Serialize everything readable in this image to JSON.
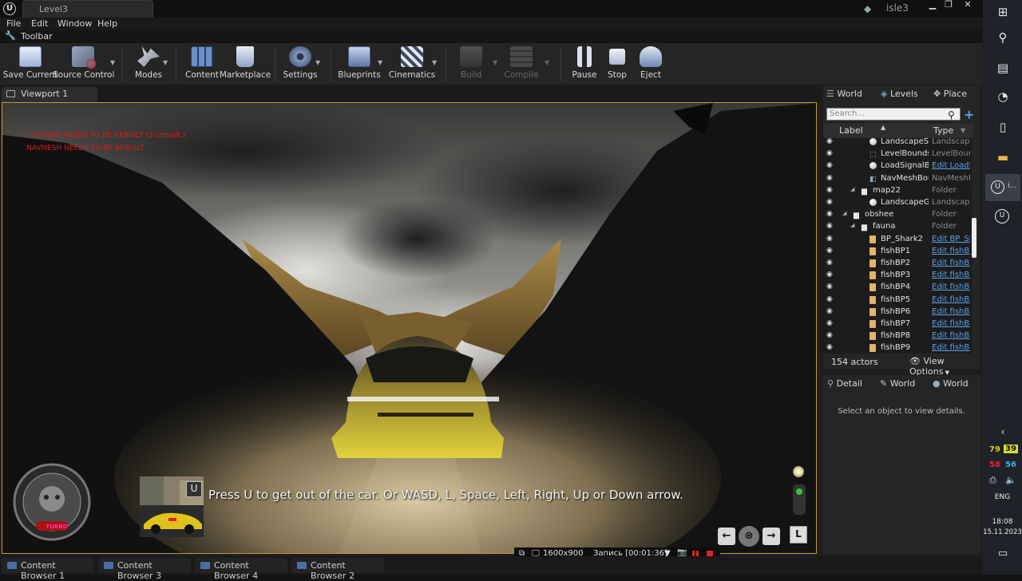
{
  "window": {
    "level_tab": "Level3",
    "project_name": "isle3"
  },
  "menu": [
    "File",
    "Edit",
    "Window",
    "Help"
  ],
  "toolbar_tab": "Toolbar",
  "toolbar": {
    "save_current": "Save Current",
    "source_control": "Source Control",
    "modes": "Modes",
    "content": "Content",
    "marketplace": "Marketplace",
    "settings": "Settings",
    "blueprints": "Blueprints",
    "cinematics": "Cinematics",
    "build": "Build",
    "compile": "Compile",
    "pause": "Pause",
    "stop": "Stop",
    "eject": "Eject"
  },
  "viewport": {
    "tab_label": "Viewport 1",
    "warning_lighting": "LIGHTING NEEDS TO BE REBUILT (3 unbuilt )",
    "warning_navmesh": "NAVMESH NEEDS TO BE REBUILT",
    "subtitle": "Press U to get out of the car. Or WASD, L, Space, Left, Right, Up or Down arrow.",
    "u_key": "U",
    "l_key": "L",
    "turbo_label": "TURBO"
  },
  "outliner": {
    "tabs": [
      "World",
      "Levels",
      "Place"
    ],
    "search_placeholder": "Search...",
    "col_label": "Label",
    "col_type": "Type",
    "rows": [
      {
        "label": "LandscapeSt",
        "type": "Landscape",
        "link": false,
        "indent": 2,
        "icon": "sphere"
      },
      {
        "label": "LevelBounds",
        "type": "LevelBoun",
        "link": false,
        "indent": 2,
        "icon": "bounds"
      },
      {
        "label": "LoadSignalB",
        "type": "Edit LoadS",
        "link": true,
        "indent": 2,
        "icon": "sphere"
      },
      {
        "label": "NavMeshBou",
        "type": "NavMeshB",
        "link": false,
        "indent": 2,
        "icon": "navmesh"
      },
      {
        "label": "map22",
        "type": "Folder",
        "link": false,
        "indent": 1,
        "icon": "folder"
      },
      {
        "label": "LandscapeGi",
        "type": "Landscape",
        "link": false,
        "indent": 2,
        "icon": "sphere"
      },
      {
        "label": "obshee",
        "type": "Folder",
        "link": false,
        "indent": 0,
        "icon": "folder"
      },
      {
        "label": "fauna",
        "type": "Folder",
        "link": false,
        "indent": 1,
        "icon": "folder"
      },
      {
        "label": "BP_Shark2",
        "type": "Edit BP_Sh",
        "link": true,
        "indent": 2,
        "icon": "bp"
      },
      {
        "label": "fishBP1",
        "type": "Edit fishBP",
        "link": true,
        "indent": 2,
        "icon": "bp"
      },
      {
        "label": "fishBP2",
        "type": "Edit fishBP",
        "link": true,
        "indent": 2,
        "icon": "bp"
      },
      {
        "label": "fishBP3",
        "type": "Edit fishBP",
        "link": true,
        "indent": 2,
        "icon": "bp"
      },
      {
        "label": "fishBP4",
        "type": "Edit fishBP",
        "link": true,
        "indent": 2,
        "icon": "bp"
      },
      {
        "label": "fishBP5",
        "type": "Edit fishBP",
        "link": true,
        "indent": 2,
        "icon": "bp"
      },
      {
        "label": "fishBP6",
        "type": "Edit fishBP",
        "link": true,
        "indent": 2,
        "icon": "bp"
      },
      {
        "label": "fishBP7",
        "type": "Edit fishBP",
        "link": true,
        "indent": 2,
        "icon": "bp"
      },
      {
        "label": "fishBP8",
        "type": "Edit fishBP",
        "link": true,
        "indent": 2,
        "icon": "bp"
      },
      {
        "label": "fishBP9",
        "type": "Edit fishBP",
        "link": true,
        "indent": 2,
        "icon": "bp"
      }
    ],
    "actor_count": "154 actors",
    "view_options": "View Options"
  },
  "details": {
    "tabs": [
      "Detail",
      "World",
      "World"
    ],
    "empty_message": "Select an object to view details."
  },
  "content_browsers": [
    "Content Browser 1",
    "Content Browser 3",
    "Content Browser 4",
    "Content Browser 2"
  ],
  "recorder": {
    "resolution": "1600x900",
    "recording": "Запись [00:01:36]"
  },
  "taskbar": {
    "tray_num_1": "79",
    "tray_num_2": "39",
    "tray_num_3": "58",
    "tray_num_4": "56",
    "language": "ENG",
    "time": "18:08",
    "date": "15.11.2023",
    "ue_item_label": "i..."
  },
  "colors": {
    "accent_orange": "#c59a2d",
    "warning_red": "#d61d1d",
    "link_blue": "#5aa1ea"
  }
}
